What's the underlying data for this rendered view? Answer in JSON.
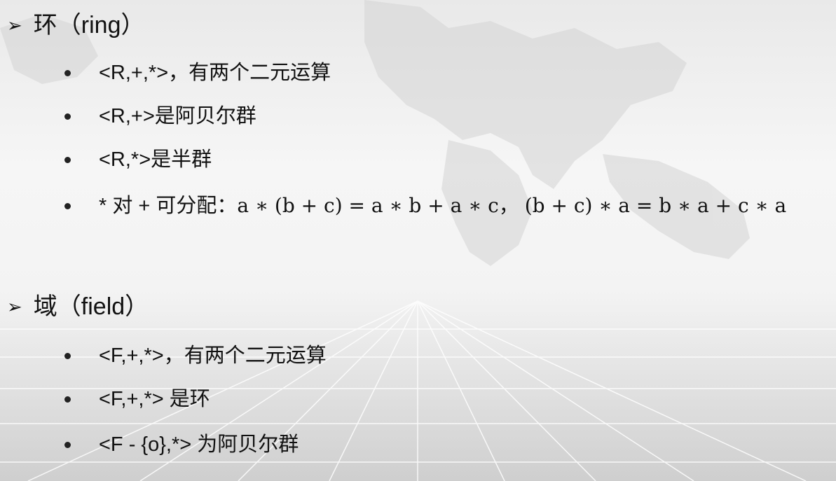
{
  "sections": [
    {
      "heading": "环（ring）",
      "items": [
        "<R,+,*>，有两个二元运算",
        "<R,+>是阿贝尔群",
        "<R,*>是半群"
      ],
      "distributive": {
        "label": "* 对 + 可分配：",
        "formula": "a ∗ (b + c) = a ∗ b + a ∗ c，  (b + c) ∗ a = b ∗ a + c ∗ a"
      }
    },
    {
      "heading": "域（field）",
      "items": [
        "<F,+,*>，有两个二元运算",
        "<F,+,*> 是环",
        "<F - {o},*> 为阿贝尔群"
      ]
    }
  ],
  "icons": {
    "heading_marker": "arrowhead-icon",
    "bullet_marker": "bullet-dot-icon"
  }
}
